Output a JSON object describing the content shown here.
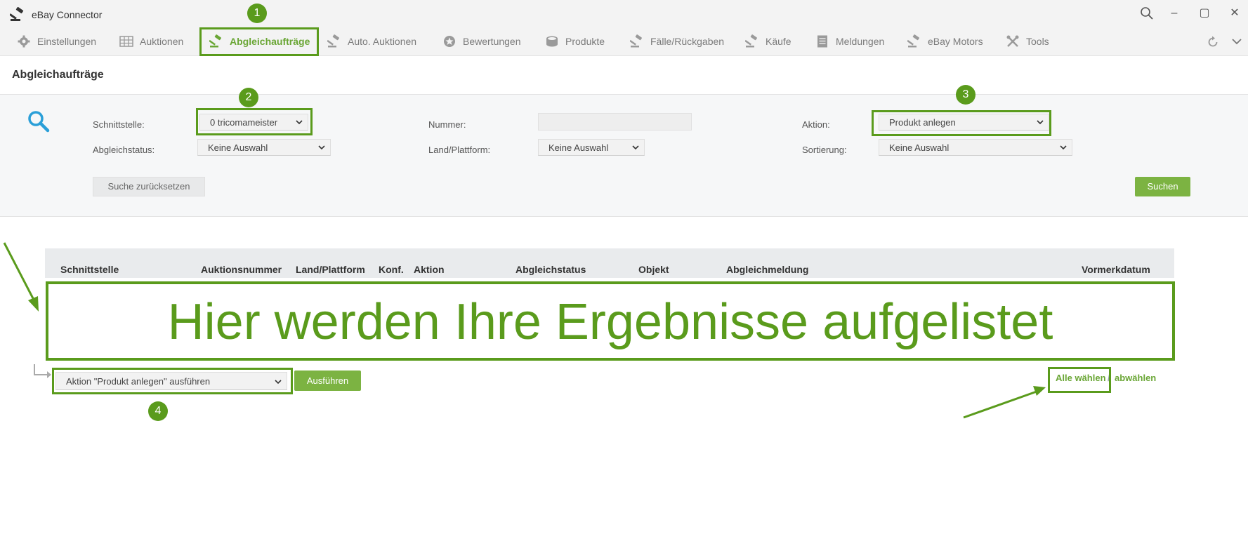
{
  "app": {
    "title": "eBay Connector",
    "accent_color": "#6aa635",
    "highlight_color": "#5a9b1c"
  },
  "window_controls": {
    "search_icon": "search-icon",
    "minimize": "–",
    "maximize": "▢",
    "close": "✕"
  },
  "tabs": [
    {
      "label": "Einstellungen",
      "icon": "gear-icon"
    },
    {
      "label": "Auktionen",
      "icon": "grid-icon"
    },
    {
      "label": "Abgleichaufträge",
      "icon": "gavel-icon",
      "active": true
    },
    {
      "label": "Auto. Auktionen",
      "icon": "gavel-icon"
    },
    {
      "label": "Bewertungen",
      "icon": "star-badge-icon"
    },
    {
      "label": "Produkte",
      "icon": "box-icon"
    },
    {
      "label": "Fälle/Rückgaben",
      "icon": "gavel-icon"
    },
    {
      "label": "Käufe",
      "icon": "gavel-icon"
    },
    {
      "label": "Meldungen",
      "icon": "list-icon"
    },
    {
      "label": "eBay Motors",
      "icon": "gavel-icon"
    },
    {
      "label": "Tools",
      "icon": "tools-icon"
    }
  ],
  "page": {
    "title": "Abgleichaufträge"
  },
  "filter": {
    "schnittstelle_label": "Schnittstelle:",
    "schnittstelle_value": "0 tricomameister",
    "abgleichstatus_label": "Abgleichstatus:",
    "abgleichstatus_value": "Keine Auswahl",
    "nummer_label": "Nummer:",
    "nummer_value": "",
    "land_label": "Land/Plattform:",
    "land_value": "Keine Auswahl",
    "aktion_label": "Aktion:",
    "aktion_value": "Produkt anlegen",
    "sortierung_label": "Sortierung:",
    "sortierung_value": "Keine Auswahl",
    "reset_label": "Suche zurücksetzen",
    "search_label": "Suchen"
  },
  "table": {
    "columns": [
      "Schnittstelle",
      "Auktionsnummer",
      "Land/Plattform",
      "Konf.",
      "Aktion",
      "Abgleichstatus",
      "Objekt",
      "Abgleichmeldung",
      "Vormerkdatum"
    ],
    "placeholder": "Hier werden Ihre Ergebnisse aufgelistet"
  },
  "bulk": {
    "action_value": "Aktion \"Produkt anlegen\" ausführen",
    "execute_label": "Ausführen",
    "select_all_label": "Alle wählen",
    "separator": "/",
    "deselect_label": "abwählen"
  },
  "badges": {
    "b1": "1",
    "b2": "2",
    "b3": "3",
    "b4": "4"
  }
}
